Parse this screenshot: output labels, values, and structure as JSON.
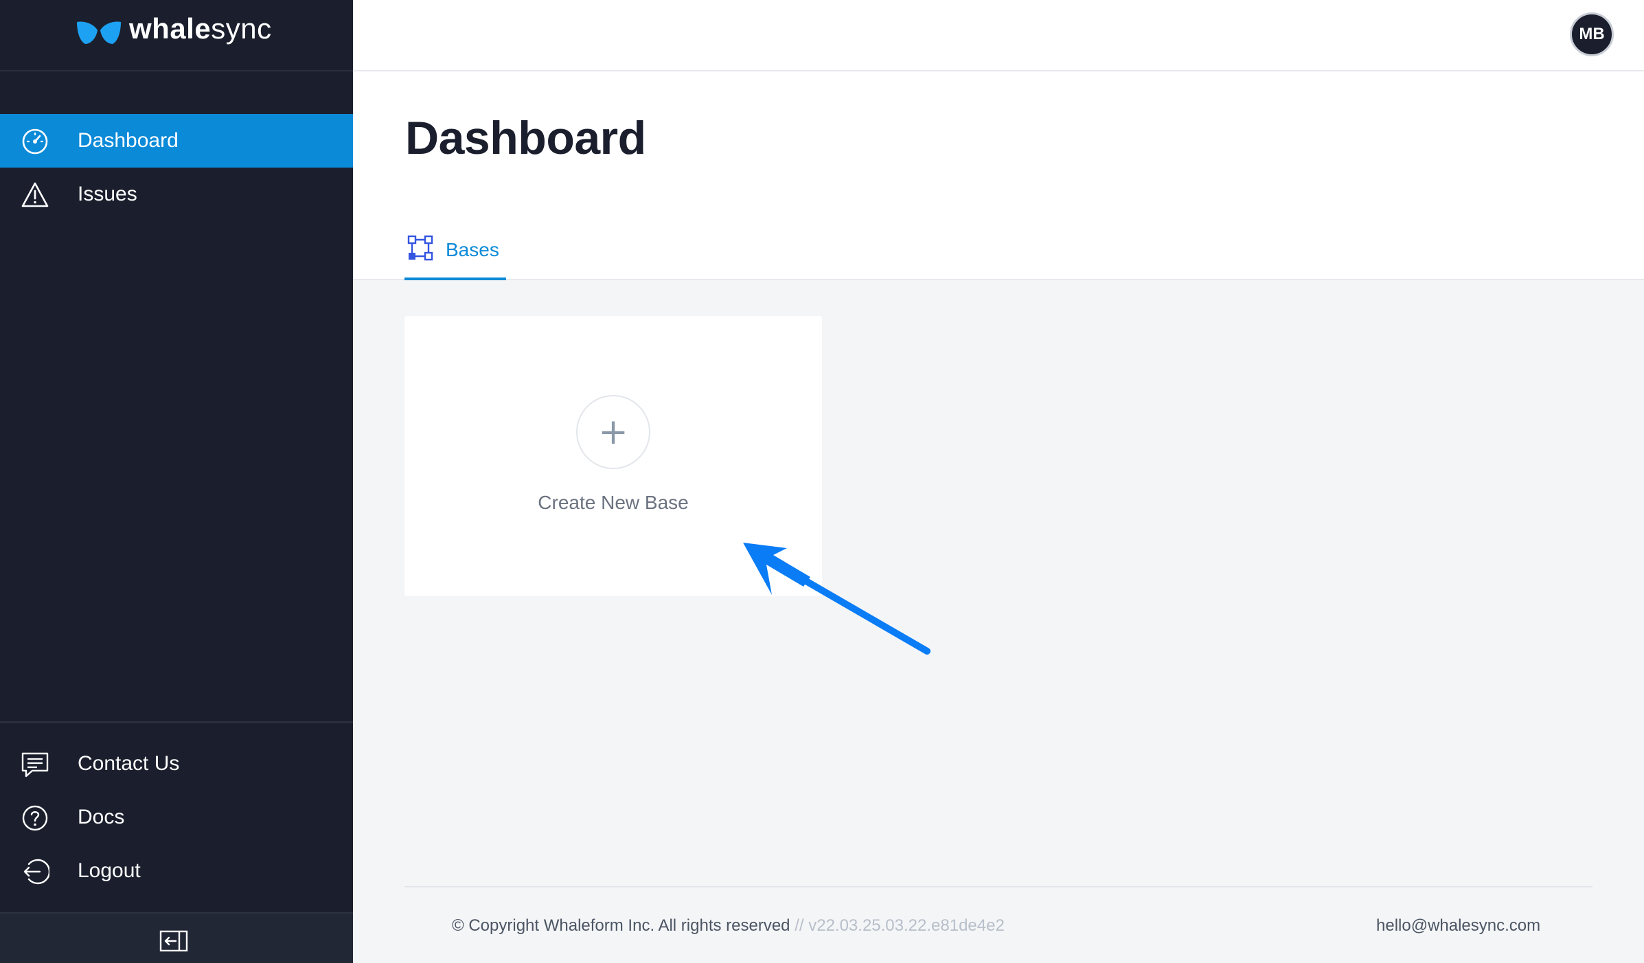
{
  "app": {
    "brand_bold": "whale",
    "brand_light": "sync"
  },
  "sidebar": {
    "items": [
      {
        "label": "Dashboard",
        "icon": "gauge-icon",
        "active": true
      },
      {
        "label": "Issues",
        "icon": "warning-icon",
        "active": false
      }
    ],
    "bottom_items": [
      {
        "label": "Contact Us",
        "icon": "chat-icon"
      },
      {
        "label": "Docs",
        "icon": "help-icon"
      },
      {
        "label": "Logout",
        "icon": "logout-icon"
      }
    ]
  },
  "user": {
    "initials": "MB"
  },
  "page": {
    "title": "Dashboard",
    "tabs": [
      {
        "label": "Bases",
        "active": true
      }
    ]
  },
  "card": {
    "plus": "+",
    "label": "Create New Base"
  },
  "footer": {
    "copyright": "© Copyright Whaleform Inc. All rights reserved",
    "separator": "//",
    "version": "v22.03.25.03.22.e81de4e2",
    "email": "hello@whalesync.com"
  },
  "colors": {
    "accent": "#0b8ad8",
    "sidebar_bg": "#1b1f2d",
    "arrow": "#0a7cf5"
  }
}
